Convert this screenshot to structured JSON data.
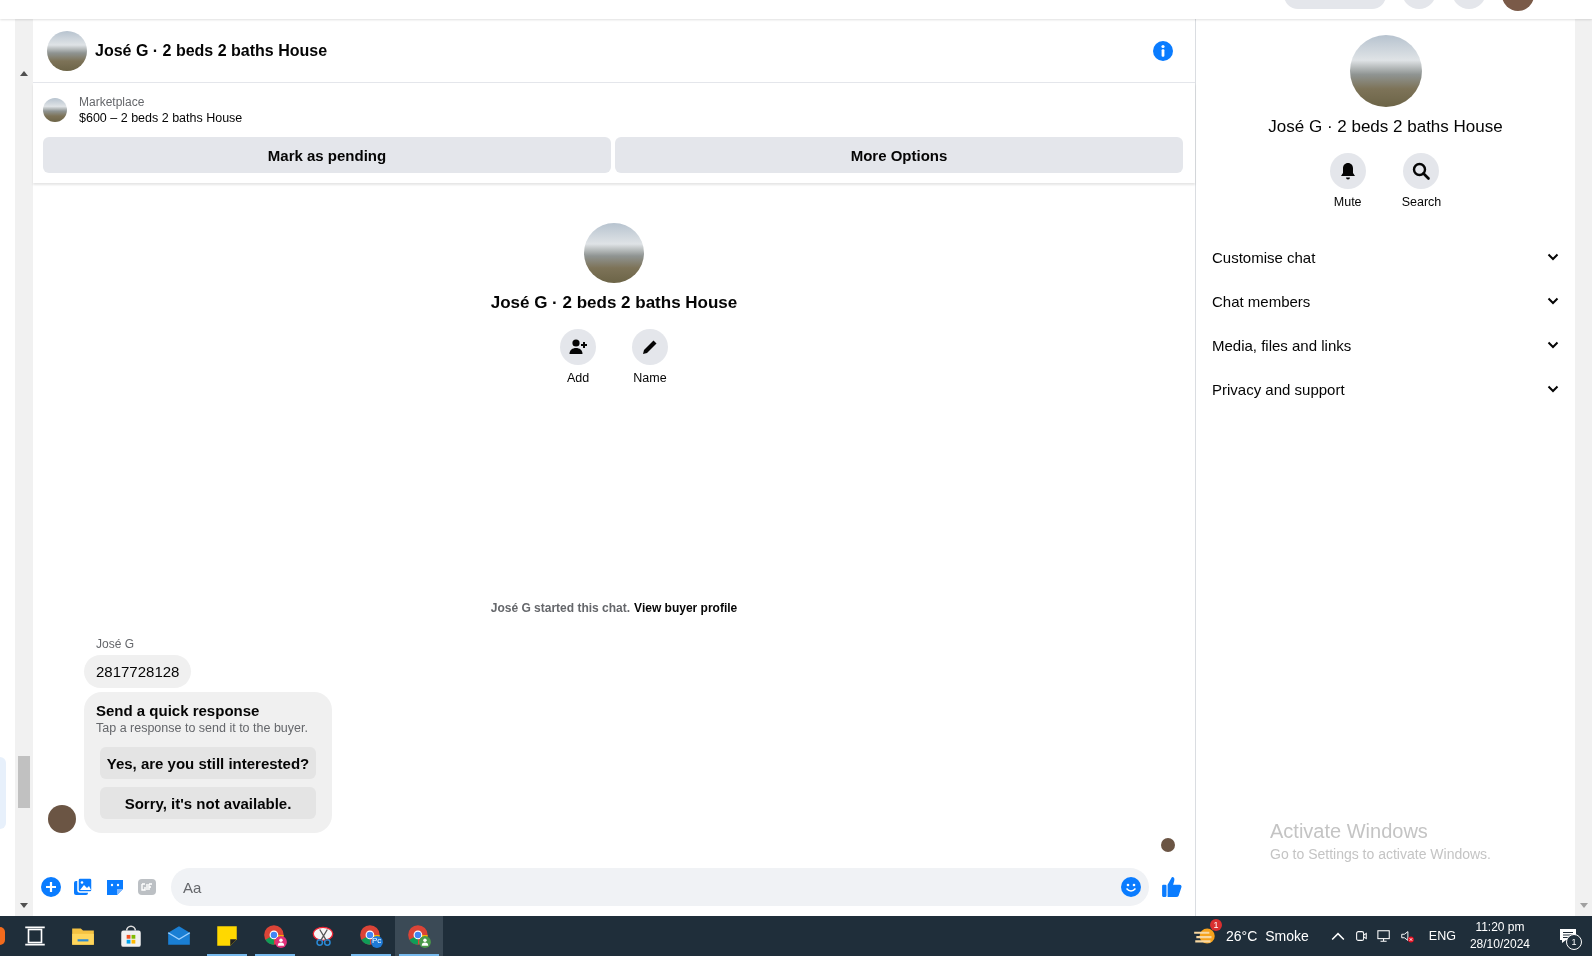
{
  "chat": {
    "title": "José G · 2 beds 2 baths House",
    "listing": {
      "source": "Marketplace",
      "title": "$600 – 2 beds 2 baths House"
    },
    "listing_actions": [
      "Mark as pending",
      "More Options"
    ],
    "intro": {
      "title": "José G · 2 beds 2 baths House",
      "actions": [
        {
          "kind": "add",
          "label": "Add"
        },
        {
          "kind": "name",
          "label": "Name"
        }
      ]
    },
    "started": {
      "text": "José G started this chat.",
      "link": "View buyer profile"
    },
    "message": {
      "sender": "José G",
      "text": "2817728128"
    },
    "quick_response": {
      "title": "Send a quick response",
      "subtitle": "Tap a response to send it to the buyer.",
      "options": [
        "Yes, are you still interested?",
        "Sorry, it's not available."
      ]
    },
    "composer": {
      "placeholder": "Aa"
    }
  },
  "details": {
    "title": "José G · 2 beds 2 baths House",
    "actions": [
      {
        "kind": "mute",
        "label": "Mute"
      },
      {
        "kind": "search",
        "label": "Search"
      }
    ],
    "sections": [
      {
        "label": "Customise chat",
        "expanded": false
      },
      {
        "label": "Chat members",
        "expanded": false
      },
      {
        "label": "Media, files and links",
        "expanded": false
      },
      {
        "label": "Privacy and support",
        "expanded": false
      }
    ]
  },
  "os_notice": {
    "title": "Activate Windows",
    "subtitle": "Go to Settings to activate Windows."
  },
  "taskbar": {
    "apps": [
      {
        "kind": "taskview",
        "running": false,
        "selected": false
      },
      {
        "kind": "explorer",
        "running": false,
        "selected": false
      },
      {
        "kind": "store",
        "running": false,
        "selected": false
      },
      {
        "kind": "mail",
        "running": false,
        "selected": false
      },
      {
        "kind": "sticky",
        "running": true,
        "selected": false
      },
      {
        "kind": "chrome-pink",
        "running": true,
        "selected": false
      },
      {
        "kind": "snip",
        "running": false,
        "selected": false
      },
      {
        "kind": "chrome-pc",
        "running": true,
        "selected": false,
        "badge": "Pc"
      },
      {
        "kind": "chrome-green",
        "running": true,
        "selected": true
      }
    ],
    "weather": {
      "badge": "1",
      "temperature": "26°C",
      "condition": "Smoke"
    },
    "language": "ENG",
    "time": "11:20 pm",
    "date": "28/10/2024",
    "notifications": "1"
  }
}
